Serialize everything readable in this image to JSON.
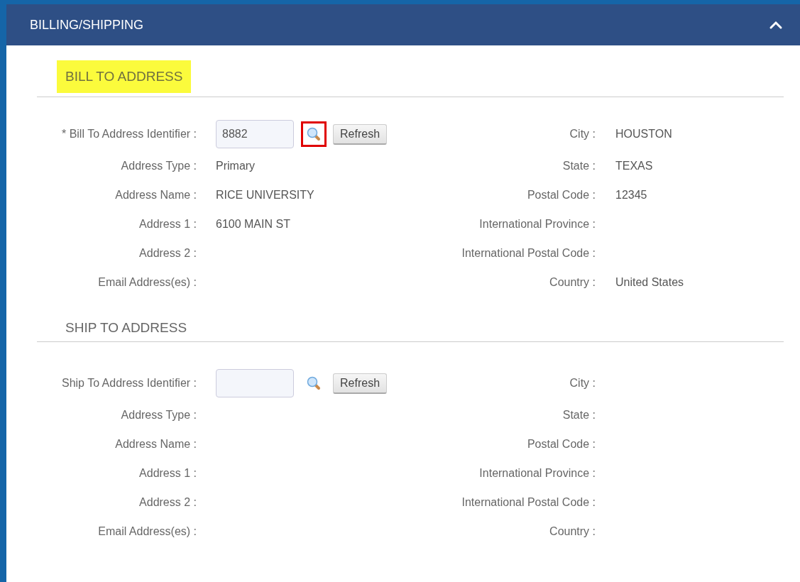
{
  "panel": {
    "title": "BILLING/SHIPPING",
    "expanded": true
  },
  "sections": [
    {
      "title": "BILL TO ADDRESS",
      "highlighted": true,
      "lookup": {
        "label": "* Bill To Address Identifier :",
        "value": "8882",
        "search_highlighted": true,
        "button": "Refresh"
      },
      "left": [
        {
          "label": "Address Type :",
          "value": "Primary"
        },
        {
          "label": "Address Name :",
          "value": "RICE UNIVERSITY"
        },
        {
          "label": "Address 1 :",
          "value": "6100 MAIN ST"
        },
        {
          "label": "Address 2 :"
        },
        {
          "label": "Email Address(es) :"
        }
      ],
      "right": [
        {
          "label": "City :",
          "value": "HOUSTON"
        },
        {
          "label": "State :",
          "value": "TEXAS"
        },
        {
          "label": "Postal Code :",
          "value": "12345"
        },
        {
          "label": "International Province :"
        },
        {
          "label": "International Postal Code :"
        },
        {
          "label": "Country :",
          "value": "United States"
        }
      ]
    },
    {
      "title": "SHIP TO ADDRESS",
      "highlighted": false,
      "lookup": {
        "label": "Ship To Address Identifier :",
        "search_highlighted": false,
        "button": "Refresh"
      },
      "left": [
        {
          "label": "Address Type :"
        },
        {
          "label": "Address Name :"
        },
        {
          "label": "Address 1 :"
        },
        {
          "label": "Address 2 :"
        },
        {
          "label": "Email Address(es) :"
        }
      ],
      "right": [
        {
          "label": "City :"
        },
        {
          "label": "State :"
        },
        {
          "label": "Postal Code :"
        },
        {
          "label": "International Province :"
        },
        {
          "label": "International Postal Code :"
        },
        {
          "label": "Country :"
        }
      ]
    }
  ]
}
